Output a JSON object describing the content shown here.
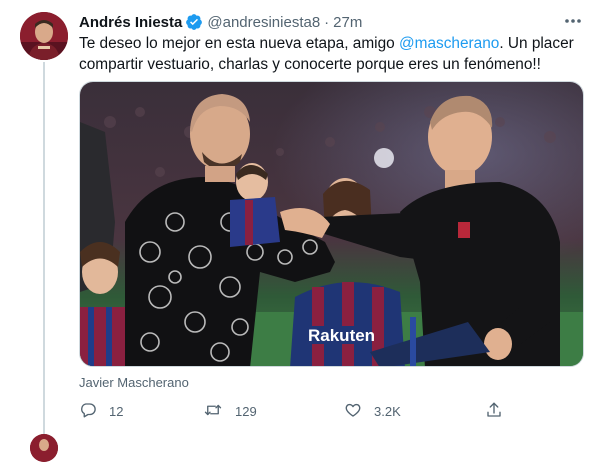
{
  "tweet": {
    "author_name": "Andrés Iniesta",
    "handle": "@andresiniesta8",
    "separator": "·",
    "time": "27m",
    "text_before": "Te deseo lo mejor en esta nueva etapa, amigo ",
    "mention": "@mascherano",
    "text_after": ". Un placer compartir vestuario, charlas y conocerte porque eres un fenómeno!!",
    "media_caption": "Javier Mascherano",
    "media_text": "Rakuten",
    "stats": {
      "replies": "12",
      "retweets": "129",
      "likes": "3.2K"
    }
  },
  "colors": {
    "link": "#1d9bf0",
    "secondary_text": "#536471",
    "verified": "#1d9bf0",
    "thread_line": "#cfd9de"
  },
  "icons": [
    "verified-badge-icon",
    "more-options-icon",
    "reply-icon",
    "retweet-icon",
    "like-icon",
    "share-icon"
  ]
}
